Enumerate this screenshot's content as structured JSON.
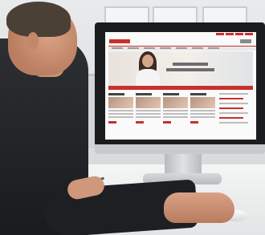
{
  "scene": {
    "subject": "man-at-computer",
    "colors": {
      "website_accent": "#c9302c",
      "shirt": "#1e1f22",
      "background": "#e4e5e6"
    }
  },
  "website": {
    "icons": [
      "hero-portrait",
      "nav-bar",
      "content-card",
      "sidebar-links"
    ]
  }
}
